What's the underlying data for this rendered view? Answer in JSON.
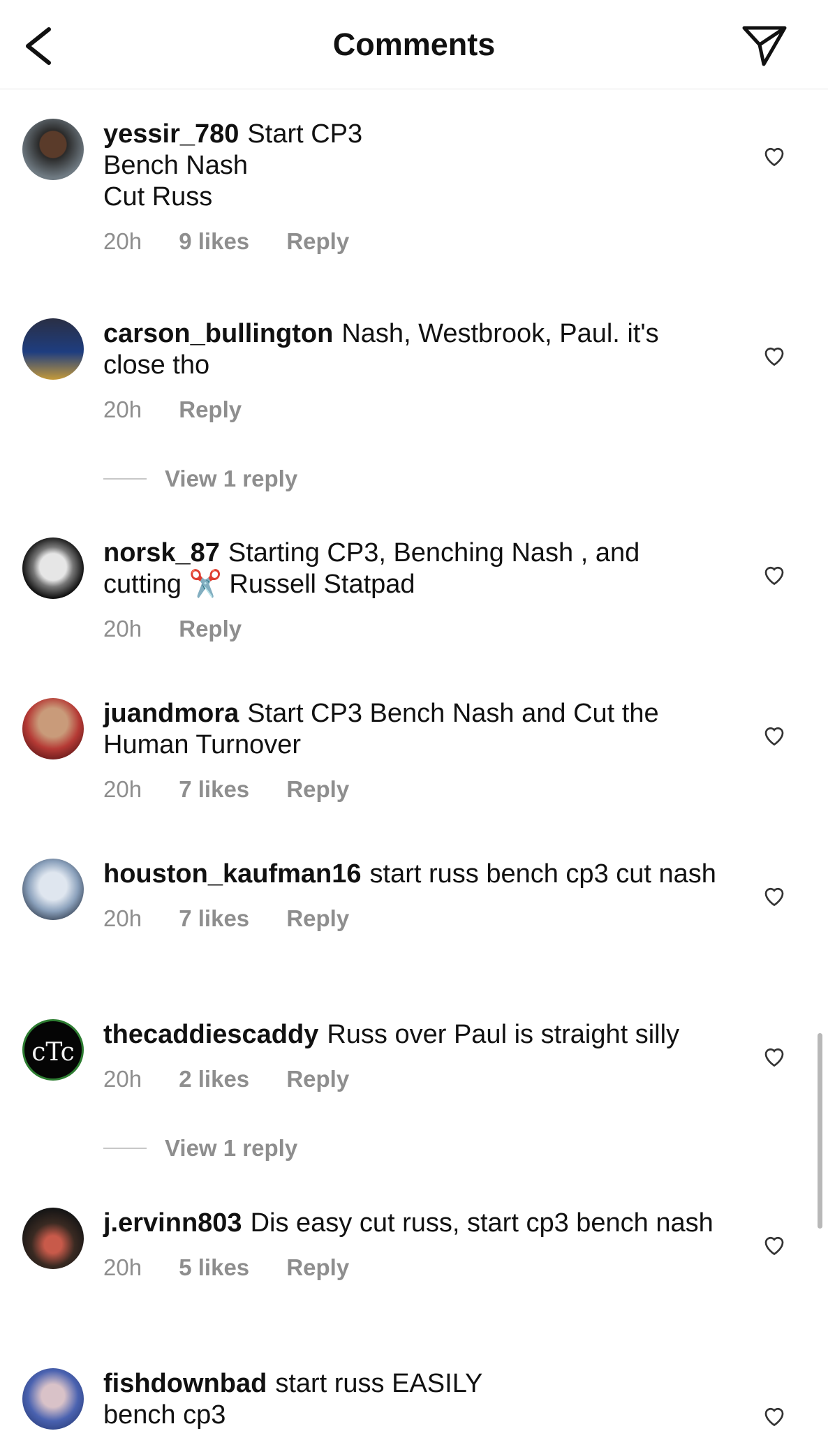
{
  "header": {
    "title": "Comments",
    "back_icon": "chevron-left-icon",
    "share_icon": "paper-plane-icon"
  },
  "comments": [
    {
      "username": "yessir_780",
      "text": "Start  CP3\nBench Nash\nCut Russ",
      "time": "20h",
      "likes": "9 likes",
      "reply": "Reply"
    },
    {
      "username": "carson_bullington",
      "text": "Nash, Westbrook, Paul. it's close tho",
      "time": "20h",
      "likes": "",
      "reply": "Reply"
    },
    {
      "username": "norsk_87",
      "text": "Starting CP3, Benching Nash , and cutting ✂️ Russell Statpad",
      "time": "20h",
      "likes": "",
      "reply": "Reply"
    },
    {
      "username": "juandmora",
      "text": "Start CP3 Bench Nash and Cut the Human Turnover",
      "time": "20h",
      "likes": "7 likes",
      "reply": "Reply"
    },
    {
      "username": "houston_kaufman16",
      "text": "start russ bench cp3 cut nash",
      "time": "20h",
      "likes": "7 likes",
      "reply": "Reply"
    },
    {
      "username": "thecaddiescaddy",
      "text": "Russ over Paul is straight silly",
      "time": "20h",
      "likes": "2 likes",
      "reply": "Reply"
    },
    {
      "username": "j.ervinn803",
      "text": "Dis easy cut russ, start cp3 bench nash",
      "time": "20h",
      "likes": "5 likes",
      "reply": "Reply"
    },
    {
      "username": "fishdownbad",
      "text": "start russ EASILY\nbench cp3",
      "time": "",
      "likes": "",
      "reply": ""
    }
  ],
  "view_replies": [
    "View 1 reply",
    "View 1 reply"
  ],
  "colors": {
    "text": "#111111",
    "meta": "#8e8e8e",
    "divider": "#e4e4e4"
  }
}
